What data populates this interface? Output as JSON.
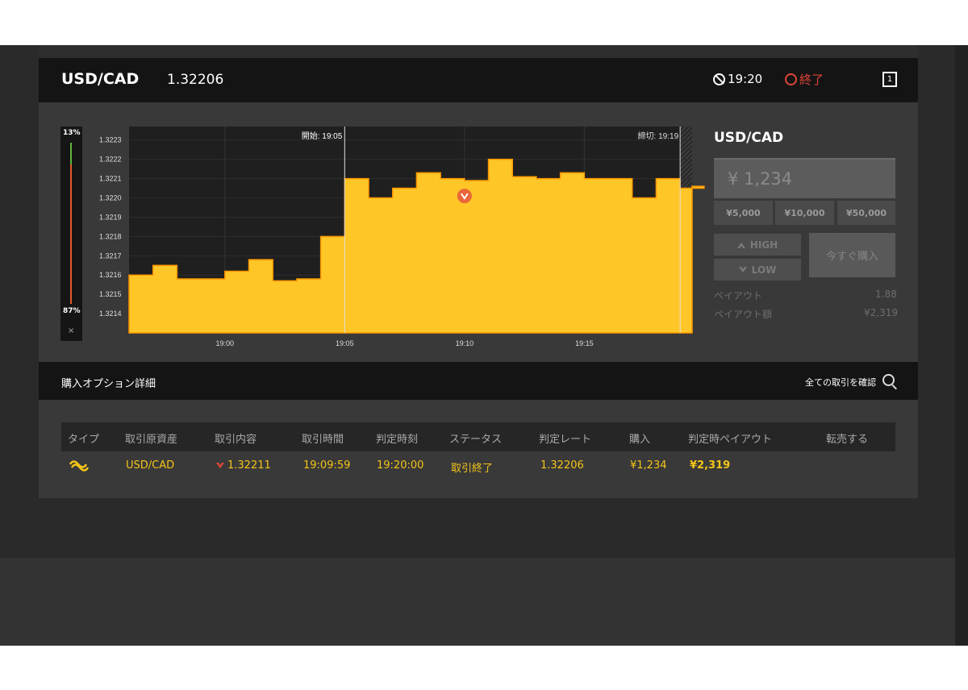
{
  "header": {
    "pair": "USD/CAD",
    "rate": "1.32206",
    "timer": "19:20",
    "status": "終了",
    "fullscreen_label": "1"
  },
  "sentiment": {
    "up": "13%",
    "down": "87%",
    "up_fraction": 0.13,
    "close": "×"
  },
  "chart_data": {
    "type": "area",
    "color": "#ffc627",
    "x": [
      "18:56",
      "18:57",
      "18:58",
      "18:59",
      "19:00",
      "19:01",
      "19:02",
      "19:03",
      "19:04",
      "19:05",
      "19:06",
      "19:07",
      "19:08",
      "19:09",
      "19:10",
      "19:11",
      "19:12",
      "19:13",
      "19:14",
      "19:15",
      "19:16",
      "19:17",
      "19:18",
      "19:19",
      "19:20"
    ],
    "y": [
      1.3216,
      1.32165,
      1.32158,
      1.32158,
      1.32162,
      1.32168,
      1.32157,
      1.32158,
      1.3218,
      1.3221,
      1.322,
      1.32205,
      1.32213,
      1.3221,
      1.32209,
      1.3222,
      1.32211,
      1.3221,
      1.32213,
      1.3221,
      1.3221,
      1.322,
      1.3221,
      1.32205,
      1.32206
    ],
    "yticks": [
      "1.3223",
      "1.3222",
      "1.3221",
      "1.3220",
      "1.3219",
      "1.3218",
      "1.3217",
      "1.3216",
      "1.3215",
      "1.3214"
    ],
    "xticks": [
      "19:00",
      "19:05",
      "19:10",
      "19:15"
    ],
    "ylim": [
      1.3213,
      1.32237
    ],
    "start_label": "開始: 19:05",
    "end_label": "締切: 19:19",
    "trade_marker": {
      "time": "19:10",
      "value": 1.32201,
      "direction": "low"
    },
    "grid": true
  },
  "order": {
    "pair": "USD/CAD",
    "amount": "¥ 1,234",
    "presets": [
      "¥5,000",
      "¥10,000",
      "¥50,000"
    ],
    "high_label": "HIGH",
    "low_label": "LOW",
    "buy_label": "今すぐ購入",
    "payout_label": "ペイアウト",
    "payout_value": "1.88",
    "payout_amount_label": "ペイアウト額",
    "payout_amount_value": "¥2,319"
  },
  "details": {
    "title": "購入オプション詳細",
    "all_trades": "全ての取引を確認",
    "columns": [
      "タイプ",
      "取引原資産",
      "取引内容",
      "取引時間",
      "判定時刻",
      "ステータス",
      "判定レート",
      "購入",
      "判定時ペイアウト",
      "転売する"
    ],
    "rows": [
      {
        "asset": "USD/CAD",
        "content": "1.32211",
        "time": "19:09:59",
        "expiry": "19:20:00",
        "status": "取引終了",
        "rate": "1.32206",
        "purchase": "¥1,234",
        "payout": "¥2,319"
      }
    ]
  },
  "colors": {
    "accent": "#ffc627",
    "danger": "#e0463a",
    "up": "#5fb53b",
    "down": "#e05a2a"
  }
}
